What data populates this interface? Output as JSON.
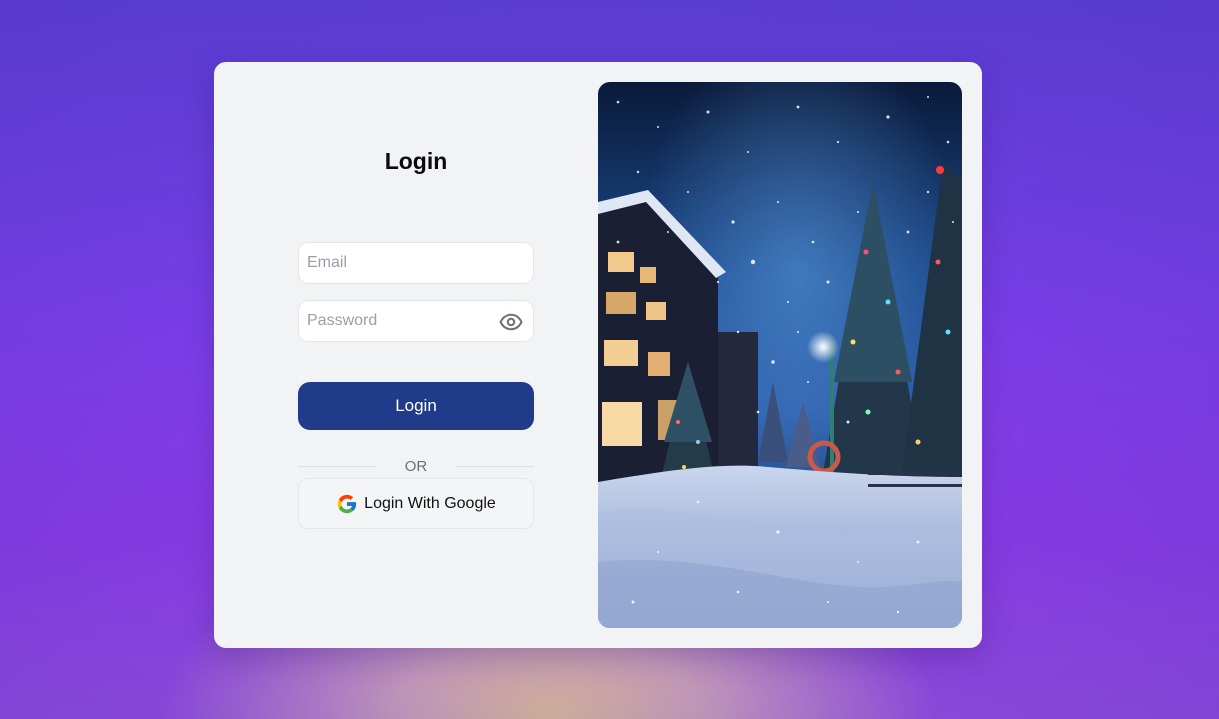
{
  "login": {
    "title": "Login",
    "email_placeholder": "Email",
    "password_placeholder": "Password",
    "submit_label": "Login",
    "divider_text": "OR",
    "google_label": "Login With Google",
    "password_toggle_icon": "eye-icon"
  },
  "colors": {
    "primary_button": "#1f3b8a",
    "card_background": "#f2f3f5",
    "page_gradient_top": "#5c3fd6",
    "page_gradient_bottom": "#9a4fe0"
  },
  "photo": {
    "subject": "snowy-village-night-scene"
  }
}
